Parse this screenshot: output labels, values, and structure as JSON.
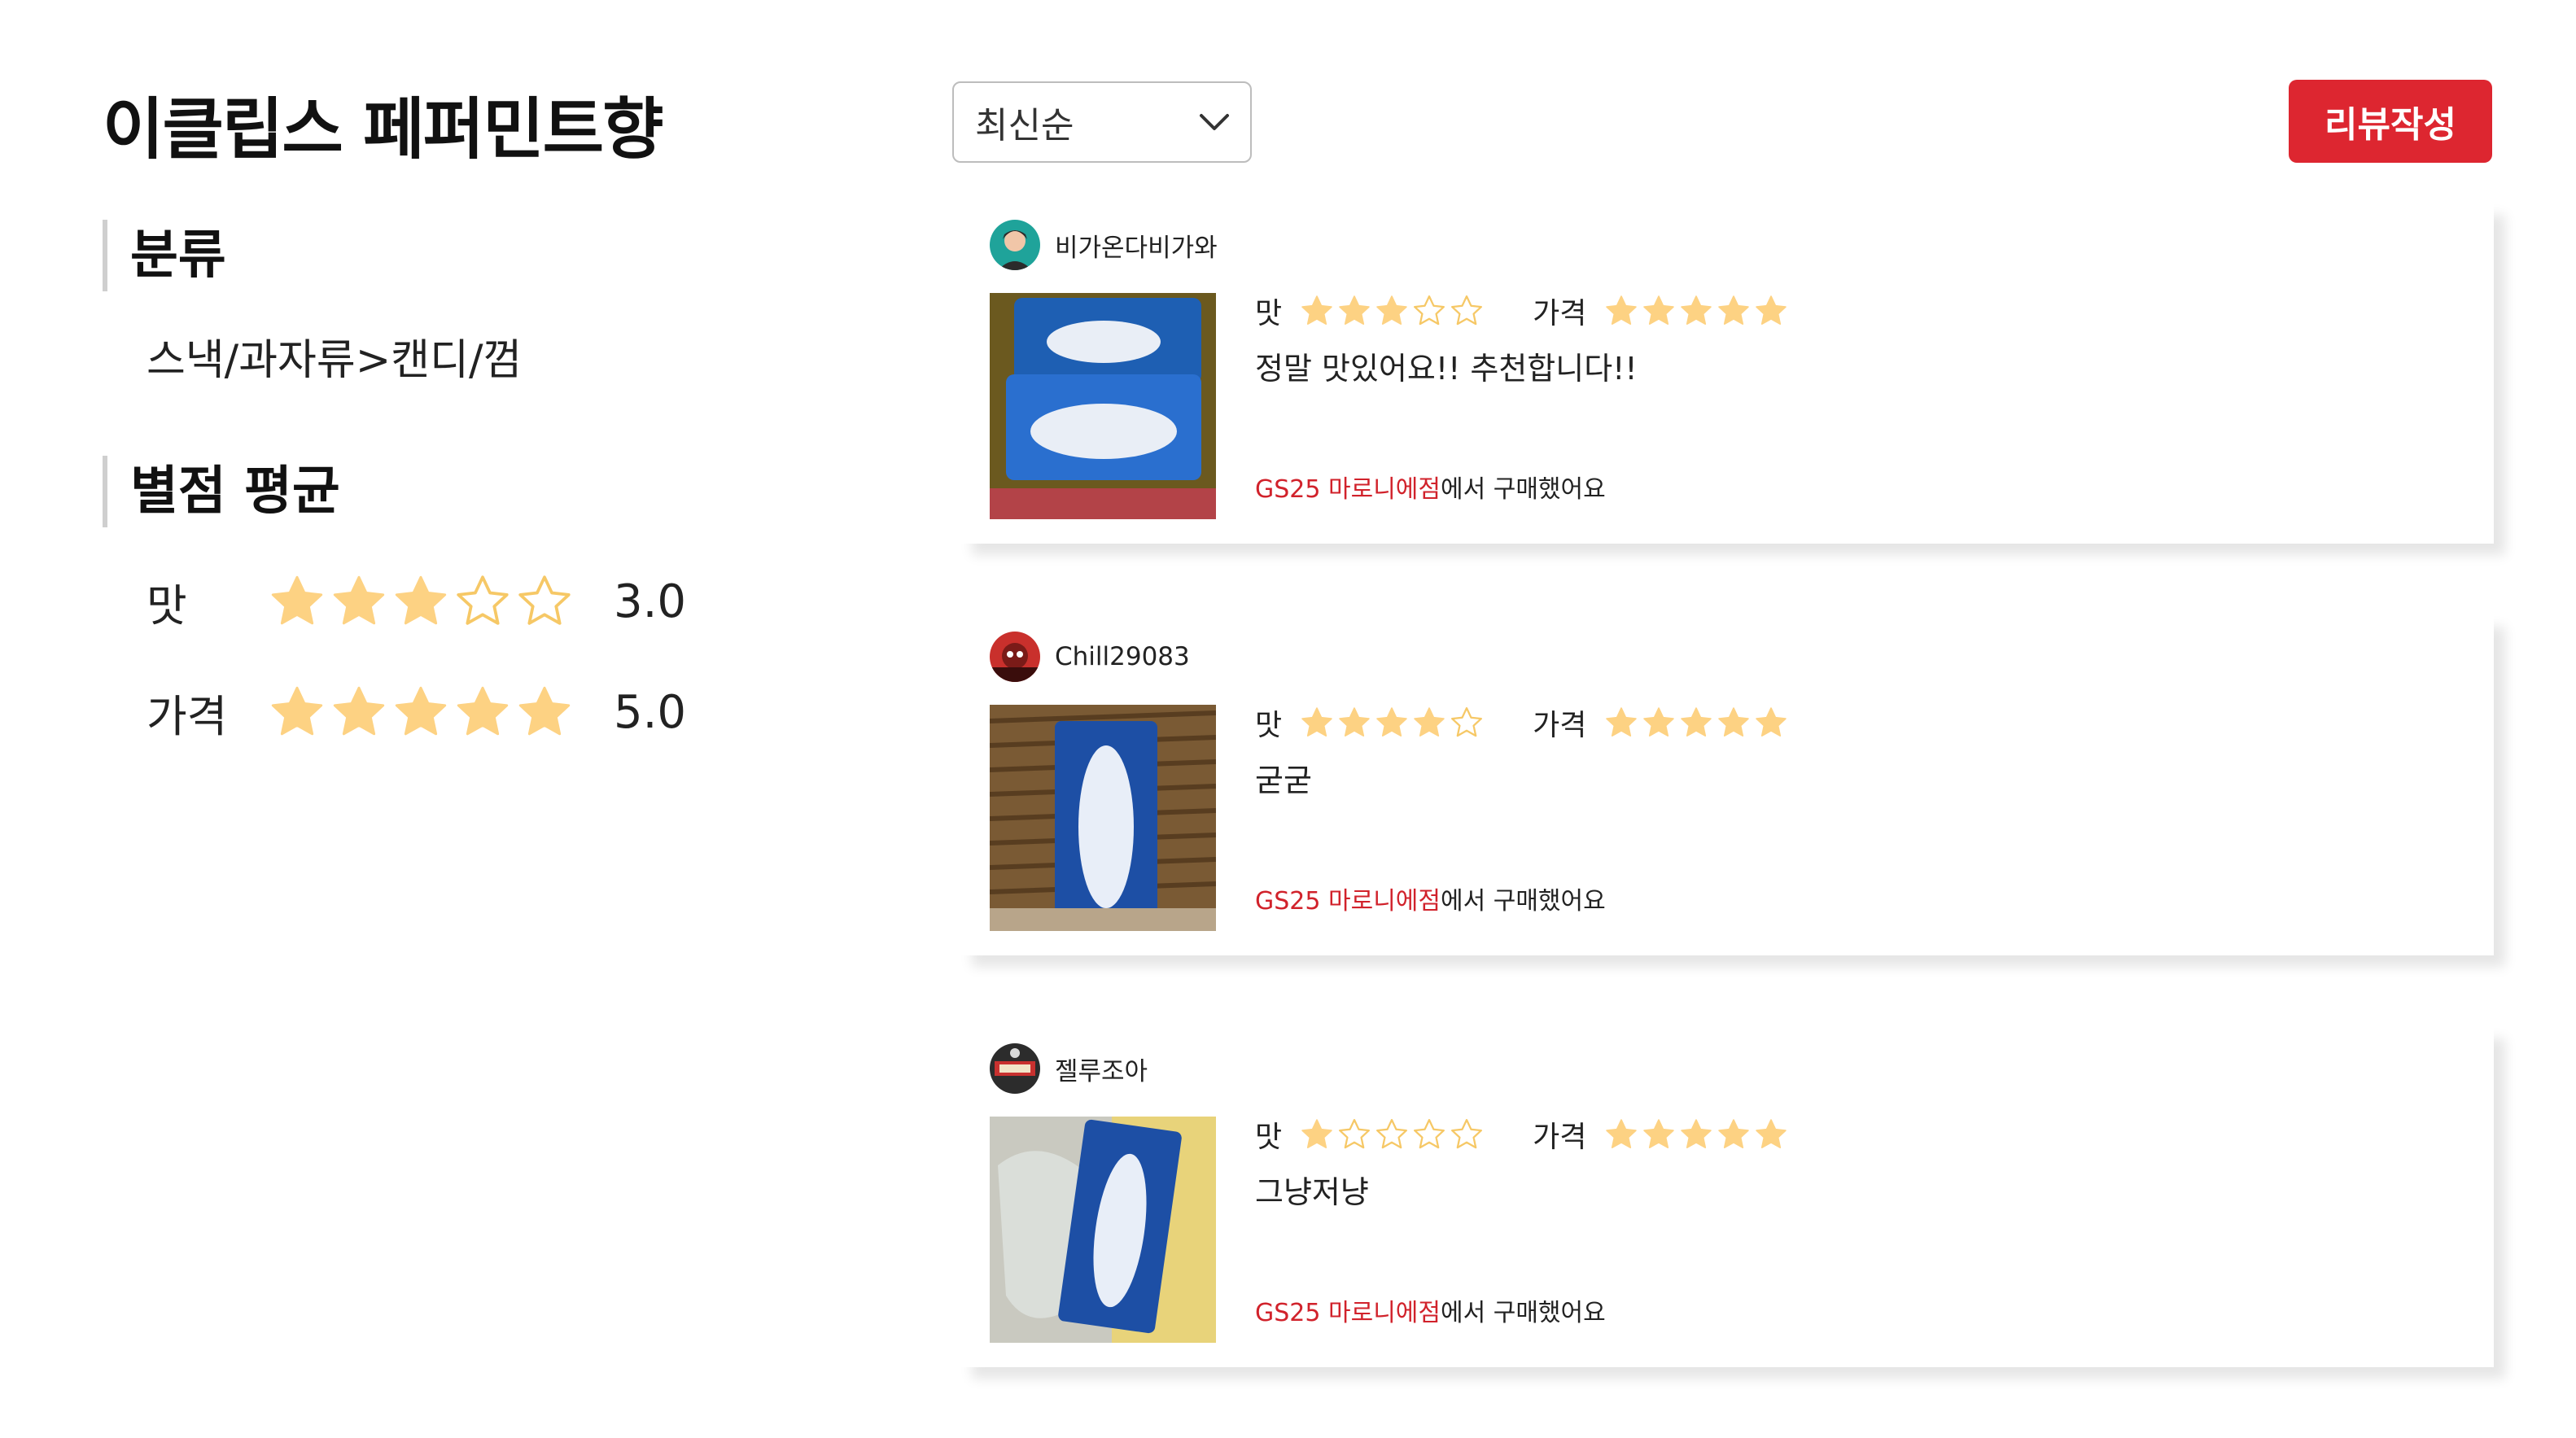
{
  "product": {
    "title": "이클립스 페퍼민트향",
    "category_heading": "분류",
    "category_path": "스낵/과자류>캔디/껌",
    "rating_heading": "별점 평균",
    "ratings": [
      {
        "label": "맛",
        "stars": 3,
        "value_text": "3.0"
      },
      {
        "label": "가격",
        "stars": 5,
        "value_text": "5.0"
      }
    ]
  },
  "toolbar": {
    "sort_selected": "최신순",
    "write_review_label": "리뷰작성"
  },
  "colors": {
    "accent_red": "#dd2630",
    "store_red": "#d1222b",
    "star_filled": "#fdd283",
    "star_empty": "#f6c866"
  },
  "reviews": [
    {
      "reviewer": "비가온다비가와",
      "taste_label": "맛",
      "taste_stars": 3,
      "price_label": "가격",
      "price_stars": 5,
      "text": "정말 맛있어요!! 추천합니다!!",
      "store": "GS25 마로니에점",
      "purchase_suffix": "에서 구매했어요"
    },
    {
      "reviewer": "Chill29083",
      "taste_label": "맛",
      "taste_stars": 4,
      "price_label": "가격",
      "price_stars": 5,
      "text": "굳굳",
      "store": "GS25 마로니에점",
      "purchase_suffix": "에서 구매했어요"
    },
    {
      "reviewer": "젤루조아",
      "taste_label": "맛",
      "taste_stars": 1,
      "price_label": "가격",
      "price_stars": 5,
      "text": "그냥저냥",
      "store": "GS25 마로니에점",
      "purchase_suffix": "에서 구매했어요"
    }
  ]
}
